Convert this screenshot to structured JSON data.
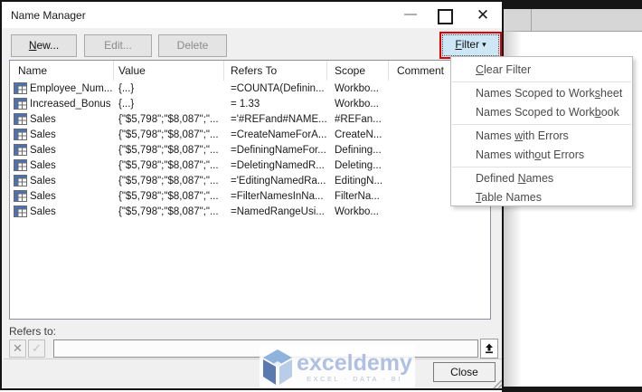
{
  "window": {
    "title": "Name Manager",
    "controls": {
      "minimize_icon": "minimize",
      "maximize_icon": "maximize",
      "close_icon": "✕"
    }
  },
  "toolbar": {
    "new": {
      "pre": "",
      "accel": "N",
      "post": "ew..."
    },
    "edit_label": "Edit...",
    "delete_label": "Delete",
    "filter": {
      "accel": "F",
      "post": "ilter",
      "caret": "▾"
    }
  },
  "table": {
    "columns": [
      "Name",
      "Value",
      "Refers To",
      "Scope",
      "Comment"
    ],
    "rows": [
      {
        "name": "Employee_Num...",
        "value": "{...}",
        "refers_to": "=COUNTA(Definin...",
        "scope": "Workbo..."
      },
      {
        "name": "Increased_Bonus",
        "value": "{...}",
        "refers_to": "= 1.33",
        "scope": "Workbo..."
      },
      {
        "name": "Sales",
        "value": "{\"$5,798\";\"$8,087\";\"...",
        "refers_to": "='#REFand#NAME...",
        "scope": "#REFan..."
      },
      {
        "name": "Sales",
        "value": "{\"$5,798\";\"$8,087\";\"...",
        "refers_to": "=CreateNameForA...",
        "scope": "CreateN..."
      },
      {
        "name": "Sales",
        "value": "{\"$5,798\";\"$8,087\";\"...",
        "refers_to": "=DefiningNameFor...",
        "scope": "Defining..."
      },
      {
        "name": "Sales",
        "value": "{\"$5,798\";\"$8,087\";\"...",
        "refers_to": "=DeletingNamedR...",
        "scope": "Deleting..."
      },
      {
        "name": "Sales",
        "value": "{\"$5,798\";\"$8,087\";\"...",
        "refers_to": "='EditingNamedRa...",
        "scope": "EditingN..."
      },
      {
        "name": "Sales",
        "value": "{\"$5,798\";\"$8,087\";\"...",
        "refers_to": "=FilterNamesInNa...",
        "scope": "FilterNa..."
      },
      {
        "name": "Sales",
        "value": "{\"$5,798\";\"$8,087\";\"...",
        "refers_to": "=NamedRangeUsi...",
        "scope": "Workbo..."
      }
    ]
  },
  "filter_menu": {
    "items": [
      {
        "pre": "",
        "accel": "C",
        "post": "lear Filter"
      },
      {
        "pre": "Names Scoped to Work",
        "accel": "s",
        "post": "heet"
      },
      {
        "pre": "Names Scoped to Work",
        "accel": "b",
        "post": "ook"
      },
      {
        "pre": "Names ",
        "accel": "w",
        "post": "ith Errors"
      },
      {
        "pre": "Names with",
        "accel": "o",
        "post": "ut Errors"
      },
      {
        "pre": "Defined ",
        "accel": "N",
        "post": "ames"
      },
      {
        "pre": "",
        "accel": "T",
        "post": "able Names"
      }
    ]
  },
  "refers_to": {
    "label": "Refers to:",
    "input_value": ""
  },
  "footer": {
    "close_label": "Close"
  },
  "watermark": {
    "name": "exceldemy",
    "tagline": "EXCEL - DATA - BI"
  },
  "colors": {
    "filter_highlight": "#cde7f7",
    "annotation_red": "#e00000",
    "table_icon_blue": "#4472c4",
    "watermark_blue": "#b0c0e2",
    "dialog_bg": "#f0f0f0"
  }
}
